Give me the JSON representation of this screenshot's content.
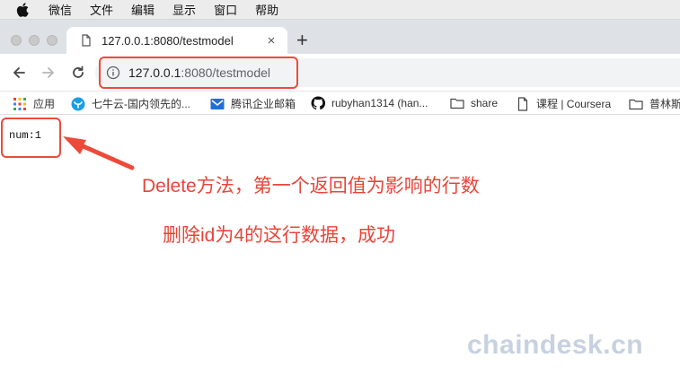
{
  "menubar": {
    "items": [
      {
        "label": "微信"
      },
      {
        "label": "文件"
      },
      {
        "label": "编辑"
      },
      {
        "label": "显示"
      },
      {
        "label": "窗口"
      },
      {
        "label": "帮助"
      }
    ]
  },
  "tab": {
    "title": "127.0.0.1:8080/testmodel",
    "close_label": "×",
    "new_tab_label": "+"
  },
  "omnibox": {
    "host": "127.0.0.1",
    "rest": ":8080/testmodel"
  },
  "bookmarks": {
    "items": [
      {
        "label": "应用",
        "icon": "apps-grid-icon"
      },
      {
        "label": "七牛云-国内领先的...",
        "icon": "qiniu-icon"
      },
      {
        "label": "腾讯企业邮箱",
        "icon": "tencent-mail-icon"
      },
      {
        "label": "rubyhan1314 (han...",
        "icon": "github-icon"
      },
      {
        "label": "share",
        "icon": "folder-icon"
      },
      {
        "label": "课程 | Coursera",
        "icon": "page-icon"
      },
      {
        "label": "普林斯",
        "icon": "folder-icon"
      }
    ]
  },
  "page": {
    "output_text": "num:1"
  },
  "annotations": {
    "line1": "Delete方法，第一个返回值为影响的行数",
    "line2": "删除id为4的这行数据，成功",
    "accent_color": "#e8453a"
  },
  "watermark": "chaindesk.cn"
}
